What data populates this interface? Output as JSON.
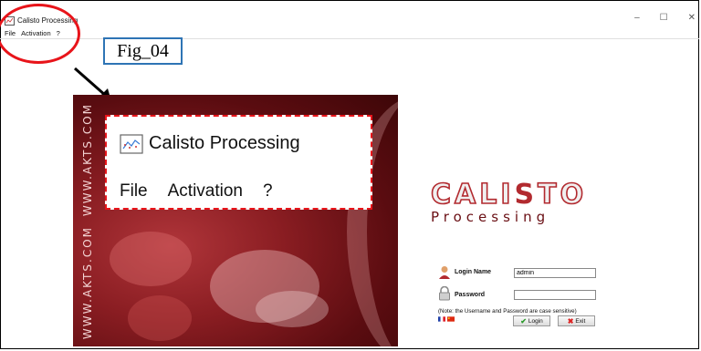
{
  "window": {
    "title": "Calisto Processing",
    "controls": [
      "–",
      "☐",
      "✕"
    ]
  },
  "menu": {
    "items": [
      "File",
      "Activation",
      "?"
    ]
  },
  "annotation": {
    "figure_label": "Fig_04"
  },
  "splash": {
    "side_text_top": "WWW.AKTS.COM",
    "side_text_bottom": "WWW.AKTS.COM",
    "zoom_title": "Calisto Processing",
    "zoom_menu": [
      "File",
      "Activation",
      "?"
    ]
  },
  "brand": {
    "name_pre": "CALI",
    "name_accent": "S",
    "name_post": "TO",
    "subtitle": "Processing"
  },
  "login": {
    "login_label": "Login Name",
    "login_value": "admin",
    "password_label": "Password",
    "password_value": "",
    "note": "(Note: the Username and Password are case sensitive)",
    "login_button": "Login",
    "exit_button": "Exit"
  },
  "colors": {
    "highlight_red": "#e8141a",
    "figure_border": "#2e74b5",
    "brand_red": "#b22a2f"
  },
  "icons": [
    "app-chart-icon",
    "user-icon",
    "lock-icon",
    "check-icon",
    "x-icon",
    "flag-fr-icon",
    "flag-cn-icon"
  ]
}
